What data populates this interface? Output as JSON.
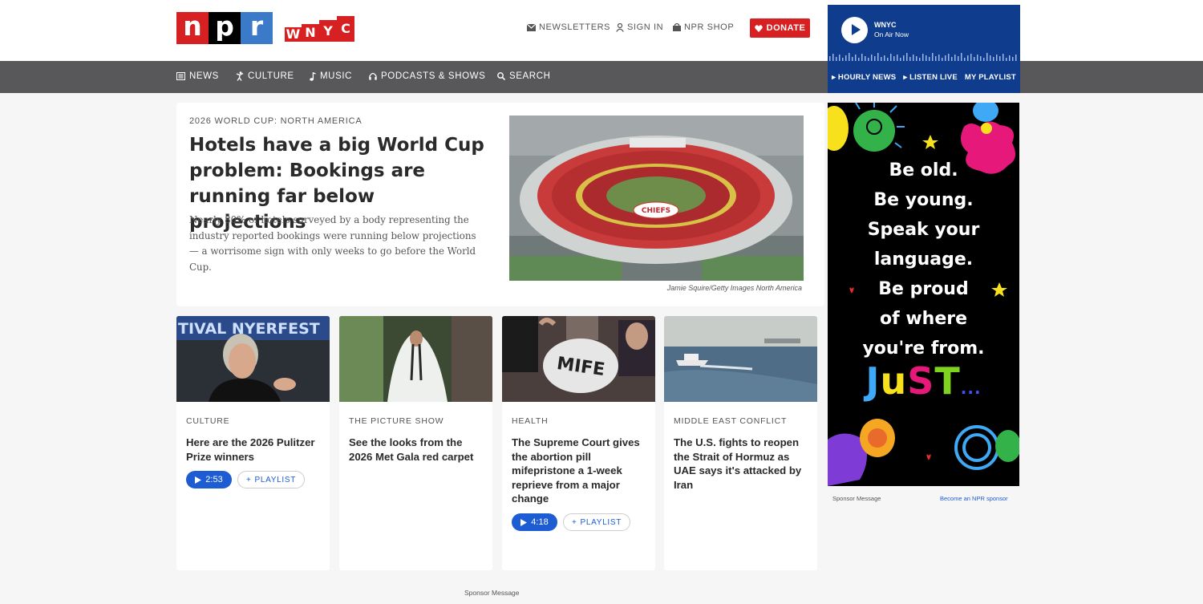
{
  "header": {
    "npr_logo": [
      "n",
      "p",
      "r"
    ],
    "wnyc_logo": [
      "W",
      "N",
      "Y",
      "C"
    ],
    "newsletters": "Newsletters",
    "sign_in": "Sign In",
    "shop": "NPR Shop",
    "donate": "Donate"
  },
  "nav": {
    "news": "News",
    "culture": "Culture",
    "music": "Music",
    "podcasts": "Podcasts & Shows",
    "search": "Search"
  },
  "player": {
    "station": "WNYC",
    "status": "On Air Now",
    "links": [
      "▸ HOURLY NEWS",
      "▸ LISTEN LIVE",
      "MY PLAYLIST"
    ]
  },
  "hero": {
    "eyebrow": "2026 WORLD CUP: NORTH AMERICA",
    "title": "Hotels have a big World Cup problem: Bookings are running far below projections",
    "description": "Nearly 80% of hotels surveyed by a body representing the industry reported bookings were running below projections — a worrisome sign with only weeks to go before the World Cup.",
    "image_text": "CHIEFS",
    "credit": "Jamie Squire/Getty Images North America"
  },
  "cards": [
    {
      "eyebrow": "CULTURE",
      "title": "Here are the 2026 Pulitzer Prize winners",
      "image_text": "TIVAL   NYERFEST",
      "duration": "2:53",
      "playlist": "PLAYLIST"
    },
    {
      "eyebrow": "THE PICTURE SHOW",
      "title": "See the looks from the 2026 Met Gala red carpet"
    },
    {
      "eyebrow": "HEALTH",
      "title": "The Supreme Court gives the abortion pill mifepristone a 1-week reprieve from a major change",
      "image_text": "MIFE",
      "duration": "4:18",
      "playlist": "PLAYLIST"
    },
    {
      "eyebrow": "MIDDLE EAST CONFLICT",
      "title": "The U.S. fights to reopen the Strait of Hormuz as UAE says it's attacked by Iran"
    }
  ],
  "ad": {
    "lines": [
      "Be old.",
      "Be young.",
      "Speak your",
      "language.",
      "Be proud",
      "of where",
      "you're from."
    ],
    "just": [
      "J",
      "u",
      "S",
      "T",
      "..."
    ],
    "just_colors": [
      "#3fa9f5",
      "#f7e01c",
      "#e6197a",
      "#7ed321",
      "#3f51ff"
    ],
    "sponsor_label": "Sponsor Message",
    "become_sponsor": "Become an NPR sponsor"
  },
  "footer": {
    "sponsor_label": "Sponsor Message"
  },
  "colors": {
    "npr_red": "#d62021",
    "npr_blue": "#3a7ac9",
    "nav_gray": "#58585a",
    "wnyc_blue": "#0f3c8c",
    "link_blue": "#1d5cd2"
  }
}
